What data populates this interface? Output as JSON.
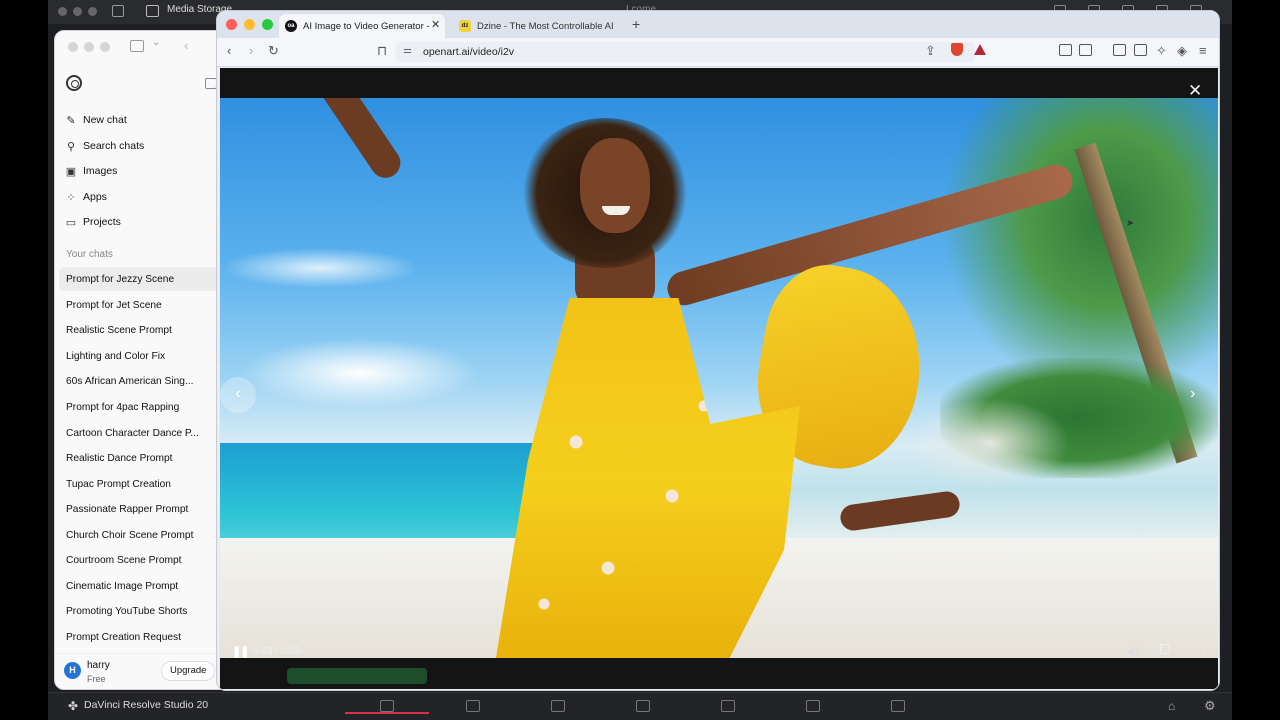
{
  "background": {
    "topbar_app": "Media Storage",
    "topbar_center": "Lcome"
  },
  "chatgpt": {
    "menu": [
      {
        "label": "New chat",
        "icon": "edit-icon"
      },
      {
        "label": "Search chats",
        "icon": "search-icon"
      },
      {
        "label": "Images",
        "icon": "image-icon"
      },
      {
        "label": "Apps",
        "icon": "apps-icon"
      },
      {
        "label": "Projects",
        "icon": "folder-icon"
      }
    ],
    "section_label": "Your chats",
    "chats": [
      "Prompt for Jezzy Scene",
      "Prompt for Jet Scene",
      "Realistic Scene Prompt",
      "Lighting and Color Fix",
      "60s African American Sing...",
      "Prompt for 4pac Rapping",
      "Cartoon Character Dance P...",
      "Realistic Dance Prompt",
      "Tupac Prompt Creation",
      "Passionate Rapper Prompt",
      "Church Choir Scene Prompt",
      "Courtroom Scene Prompt",
      "Cinematic Image Prompt",
      "Promoting YouTube Shorts",
      "Prompt Creation Request"
    ],
    "active_chat_index": 0,
    "user": {
      "initial": "H",
      "name": "harry",
      "plan": "Free",
      "upgrade_label": "Upgrade"
    }
  },
  "browser": {
    "tabs": [
      {
        "title": "AI Image to Video Generator -",
        "favicon": "oa",
        "active": true
      },
      {
        "title": "Dzine - The Most Controllable AI Ir",
        "favicon": "dz",
        "active": false
      }
    ],
    "url": "openart.ai/video/i2v"
  },
  "video": {
    "time_current": "0:03",
    "time_total": "0:05",
    "time_display": "0:03 / 0:05",
    "progress_fraction": 0.68
  },
  "resolve": {
    "title": "DaVinci Resolve Studio 20"
  },
  "colors": {
    "accent_brave": "#e0482d",
    "progress_fill": "#f2f2f2",
    "resolve_active": "#d6314b"
  }
}
